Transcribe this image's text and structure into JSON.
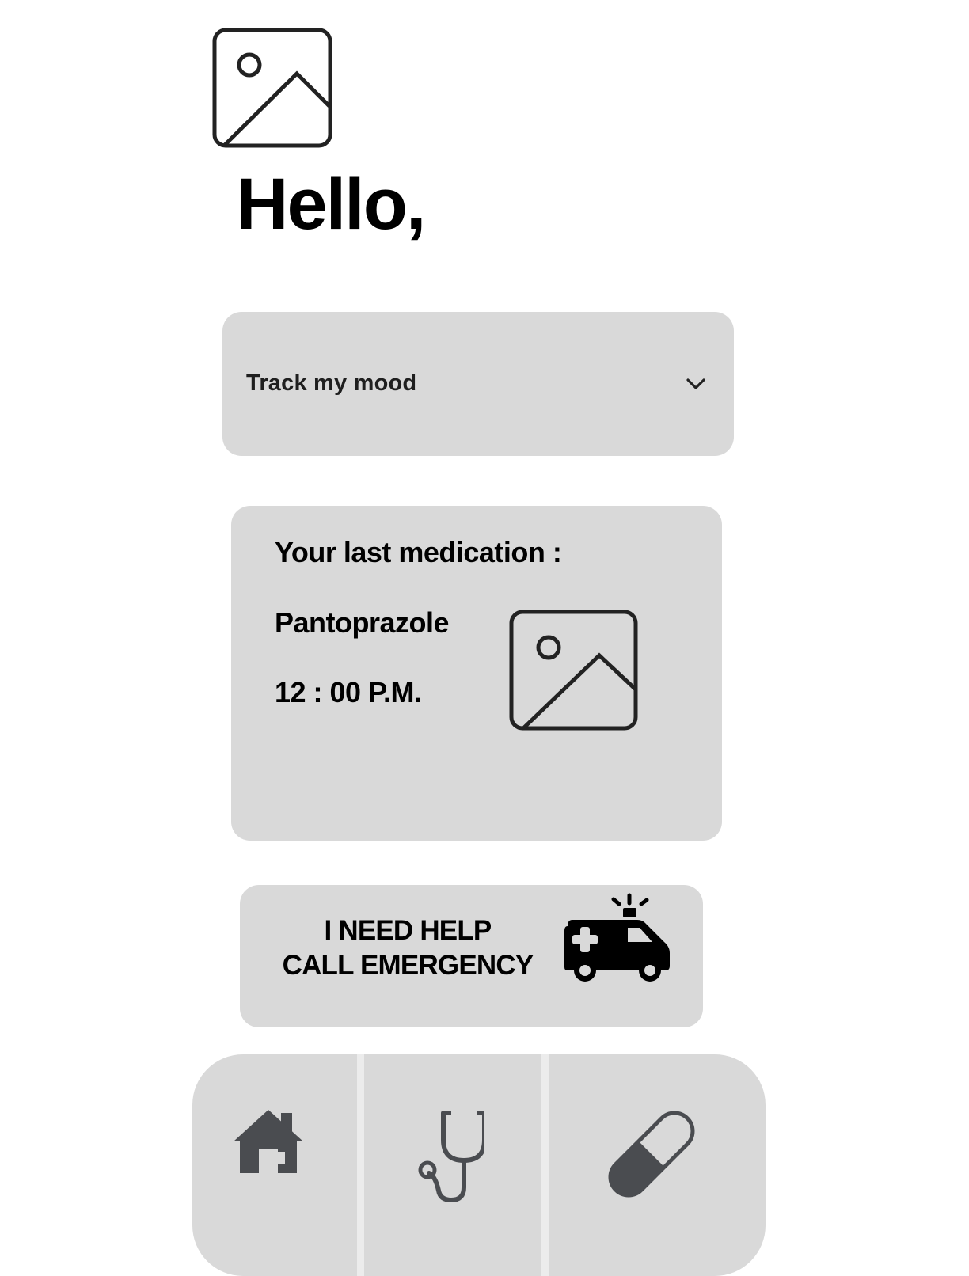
{
  "greeting": "Hello,",
  "mood_dropdown": {
    "label": "Track my mood"
  },
  "medication_card": {
    "heading": "Your last medication :",
    "name": "Pantoprazole",
    "time": "12 : 00 P.M."
  },
  "emergency": {
    "line1": "I NEED HELP",
    "line2": "CALL EMERGENCY"
  },
  "icons": {
    "profile": "image-placeholder-icon",
    "medication": "image-placeholder-icon",
    "emergency": "ambulance-icon",
    "mood_toggle": "chevron-down-icon"
  },
  "nav": {
    "items": [
      {
        "icon": "home-icon"
      },
      {
        "icon": "stethoscope-icon"
      },
      {
        "icon": "pill-icon"
      }
    ]
  },
  "colors": {
    "card": "#d9d9d9",
    "text": "#000000",
    "icon": "#4a4c50",
    "nav_divider": "#ececec"
  }
}
